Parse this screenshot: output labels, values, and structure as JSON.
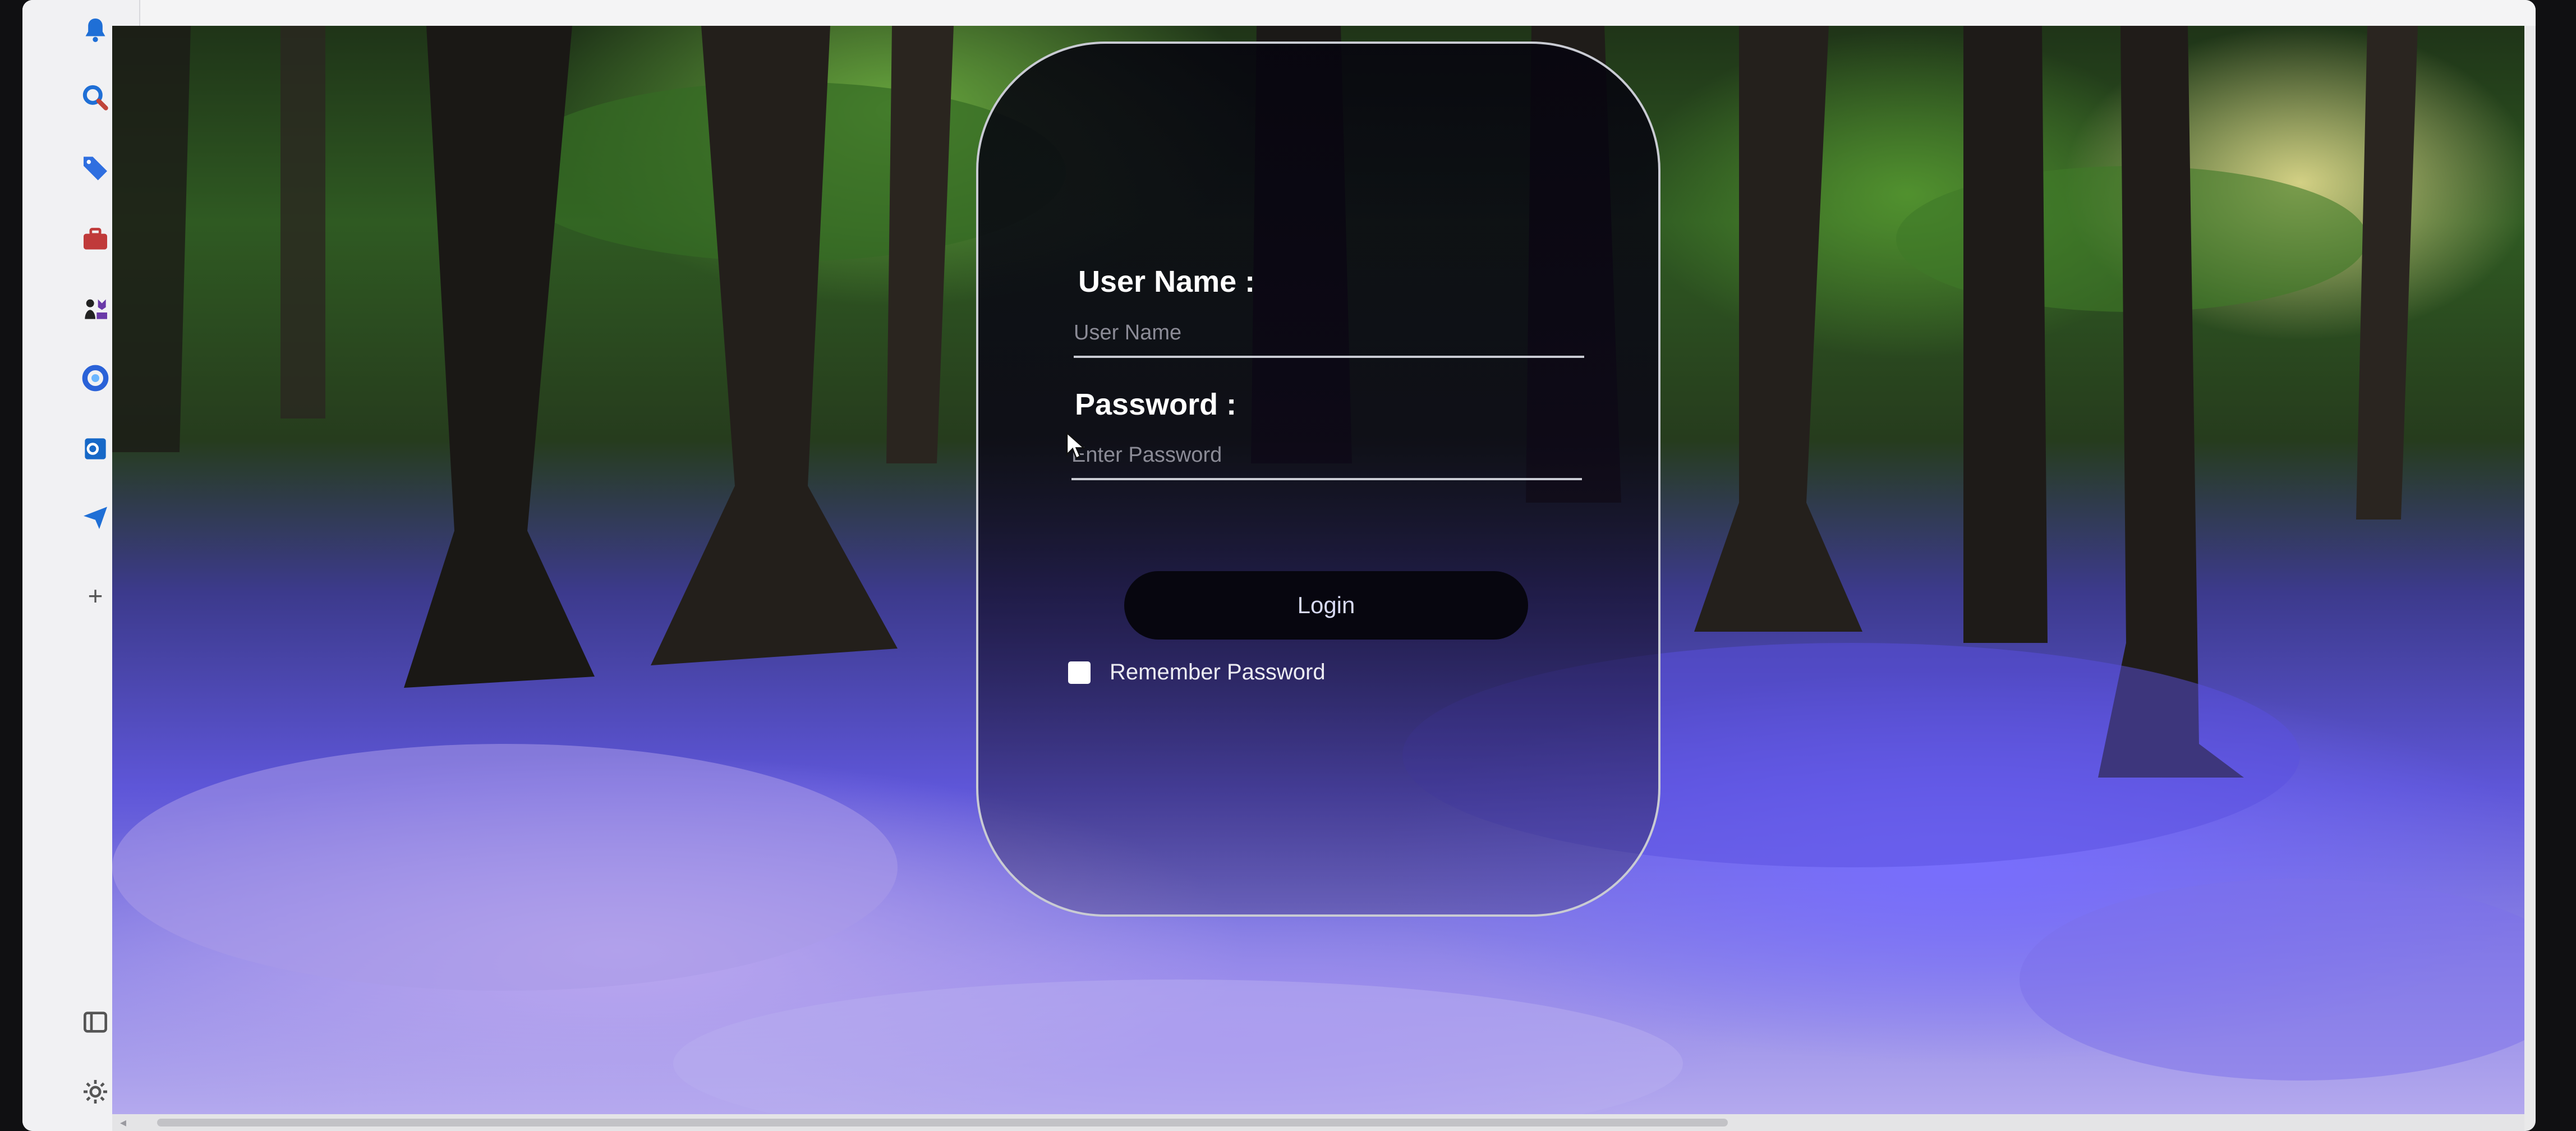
{
  "sidebar": {
    "icons": [
      {
        "name": "bell-icon",
        "color": "#1f6fd6"
      },
      {
        "name": "search-icon",
        "color": "#1f6fd6"
      },
      {
        "name": "tag-icon",
        "color": "#2f6fe0"
      },
      {
        "name": "briefcase-icon",
        "color": "#c03a3a"
      },
      {
        "name": "chess-icon",
        "color": "#6a3aa8"
      },
      {
        "name": "copilot-icon",
        "color": "#2a62d8"
      },
      {
        "name": "outlook-icon",
        "color": "#1668c7"
      },
      {
        "name": "send-icon",
        "color": "#1f6fd6"
      },
      {
        "name": "add-icon",
        "color": "#555555"
      },
      {
        "name": "sidebar-toggle-icon",
        "color": "#555555"
      },
      {
        "name": "gear-icon",
        "color": "#555555"
      }
    ],
    "add_glyph": "+"
  },
  "login": {
    "username_label": "User Name :",
    "username_placeholder": "User Name",
    "username_value": "",
    "password_label": "Password :",
    "password_placeholder": "Enter Password",
    "password_value": "",
    "login_button": "Login",
    "remember_label": "Remember Password",
    "remember_checked": false
  },
  "colors": {
    "card_border": "#c9cbd3",
    "button_text": "#d8daf5"
  }
}
